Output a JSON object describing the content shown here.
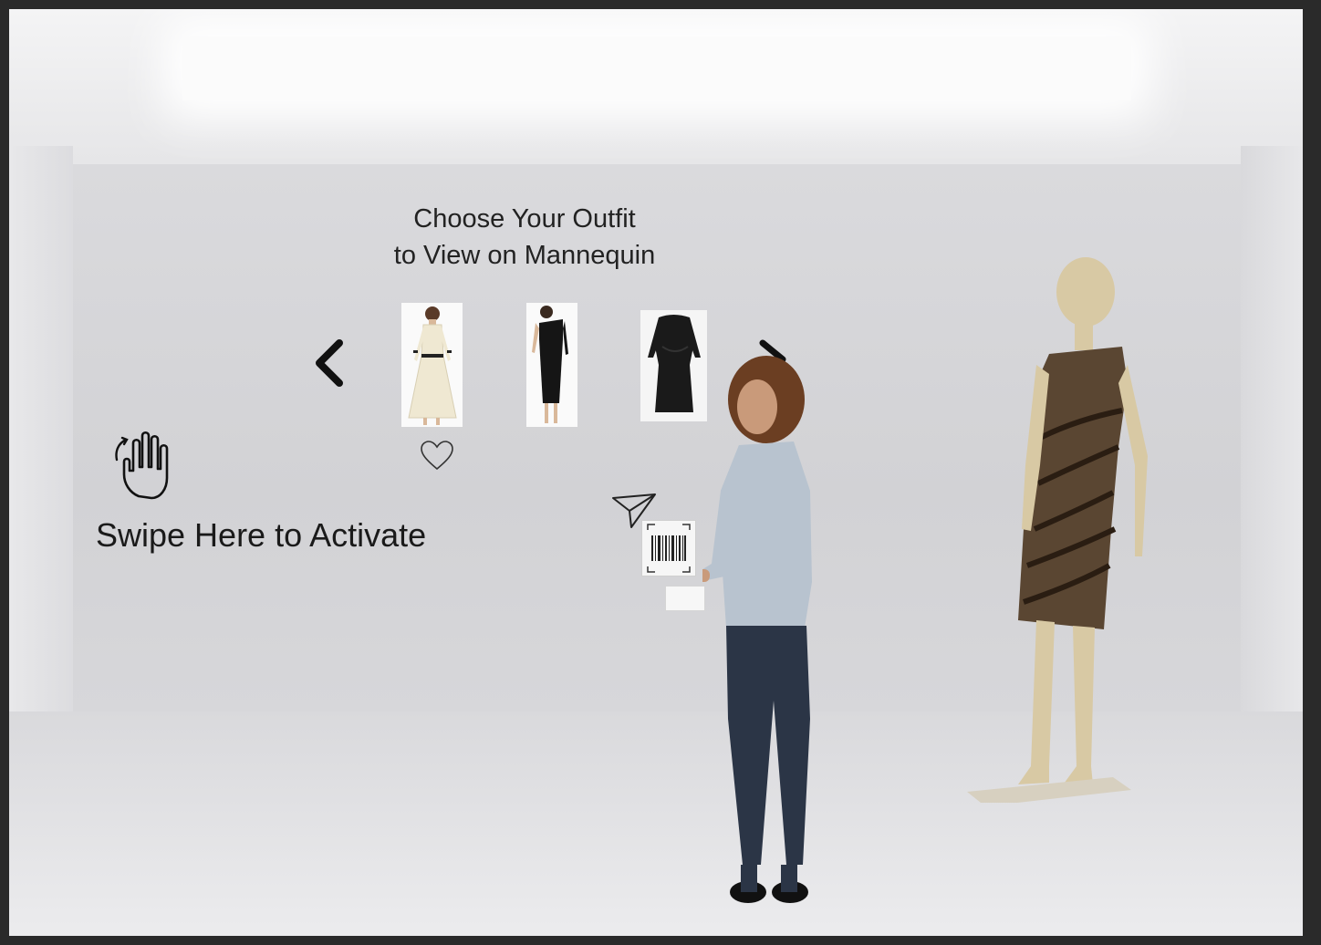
{
  "kiosk": {
    "title_line1": "Choose Your Outfit",
    "title_line2": "to View on Mannequin",
    "swipe_label": "Swipe Here to Activate"
  },
  "carousel": {
    "items": [
      {
        "name": "cream-dress",
        "color": "#efe8d2"
      },
      {
        "name": "black-one-shoulder-dress",
        "color": "#151515"
      },
      {
        "name": "black-draped-dress",
        "color": "#1a1a1a"
      }
    ]
  },
  "icons": {
    "prev": "chevron-left-icon",
    "next": "chevron-right-icon",
    "favorite": "heart-icon",
    "gesture": "wave-hand-icon",
    "share": "send-icon",
    "scan": "barcode-icon"
  },
  "colors": {
    "mannequin_dress": "#5a4632",
    "mannequin_skin": "#d8c9a4"
  }
}
